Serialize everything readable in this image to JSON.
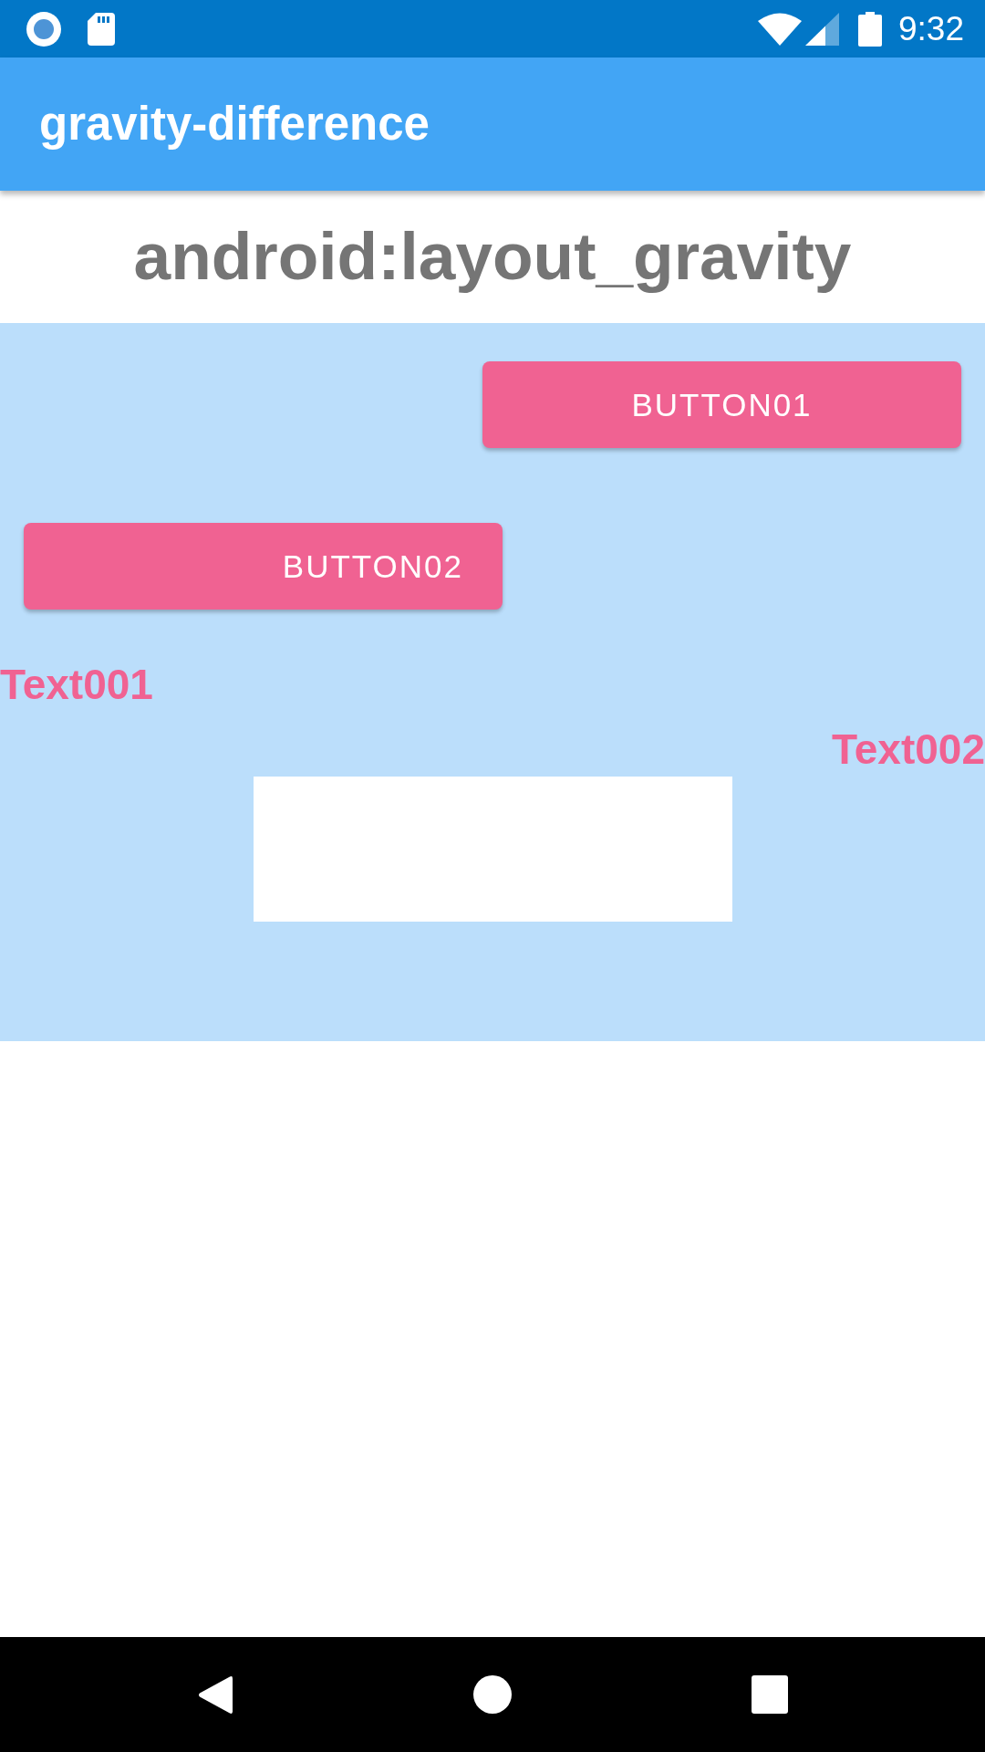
{
  "status_bar": {
    "time": "9:32"
  },
  "app_bar": {
    "title": "gravity-difference"
  },
  "heading": "android:layout_gravity",
  "panel": {
    "buttons": [
      {
        "label": "BUTTON01"
      },
      {
        "label": "BUTTON02"
      }
    ],
    "texts": [
      "Text001",
      "Text002"
    ]
  }
}
